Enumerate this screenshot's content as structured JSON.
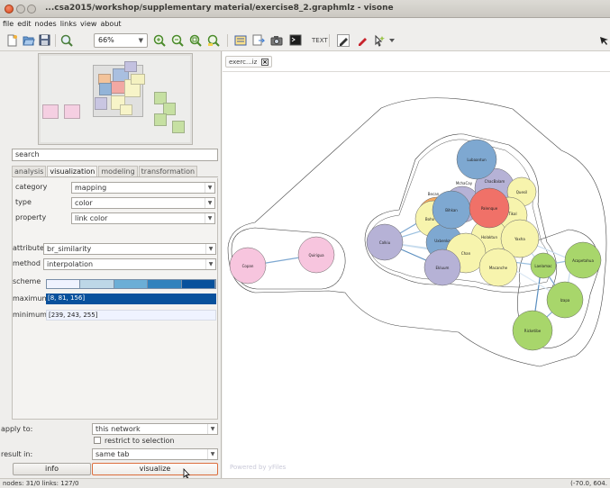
{
  "window": {
    "title": "...csa2015/workshop/supplementary material/exercise8_2.graphmlz - visone"
  },
  "menu": [
    "file",
    "edit",
    "nodes",
    "links",
    "view",
    "about"
  ],
  "toolbar": {
    "zoom": "66%",
    "text_label": "TEXT"
  },
  "search": {
    "value": "search"
  },
  "tabs": [
    "analysis",
    "visualization",
    "modeling",
    "transformation"
  ],
  "form": {
    "category": {
      "label": "category",
      "value": "mapping"
    },
    "type": {
      "label": "type",
      "value": "color"
    },
    "property": {
      "label": "property",
      "value": "link color"
    },
    "attribute": {
      "label": "attribute",
      "value": "br_similarity"
    },
    "method": {
      "label": "method",
      "value": "interpolation"
    },
    "scheme": {
      "label": "scheme",
      "colors": [
        "#eff3ff",
        "#bdd7e7",
        "#6baed6",
        "#3182bd",
        "#08519c"
      ]
    },
    "maximum": {
      "label": "maximum",
      "value": "[8, 81, 156]",
      "color": "#08519c"
    },
    "minimum": {
      "label": "minimum",
      "value": "[239, 243, 255]",
      "color": "#eff3ff"
    }
  },
  "apply": {
    "apply_label": "apply to:",
    "apply_value": "this network",
    "restrict_label": "restrict to selection",
    "result_label": "result in:",
    "result_value": "same tab",
    "info_button": "info",
    "visualize_button": "visualize"
  },
  "document_tab": {
    "label": "exerc...iz"
  },
  "canvas": {
    "powered_by": "Powered by yFiles"
  },
  "graph": {
    "nodes": [
      {
        "id": "copan",
        "label": "Copan",
        "color": "#f7c5de"
      },
      {
        "id": "quirigua",
        "label": "Quirigua",
        "color": "#f7c5de"
      },
      {
        "id": "calkiu",
        "label": "Calkiu",
        "color": "#b6b2d6"
      },
      {
        "id": "lubaantun",
        "label": "Lubaantun",
        "color": "#7ea8d1"
      },
      {
        "id": "machaquila",
        "label": "MchaCay",
        "color": "#b6b2d6"
      },
      {
        "id": "chacbalam",
        "label": "ChacBalam",
        "color": "#b6b2d6"
      },
      {
        "id": "becan",
        "label": "Becan",
        "color": "#f6a95e"
      },
      {
        "id": "quesil",
        "label": "Quesil",
        "color": "#f7f4ad"
      },
      {
        "id": "bihkan",
        "label": "Bihkan",
        "color": "#7ea8d1"
      },
      {
        "id": "palenque",
        "label": "Palenque",
        "color": "#f07168"
      },
      {
        "id": "tikal",
        "label": "Tikal",
        "color": "#f7f4ad"
      },
      {
        "id": "bolon",
        "label": "Boho",
        "color": "#f7f4ad"
      },
      {
        "id": "uxbenka",
        "label": "Uxbenka",
        "color": "#7ea8d1"
      },
      {
        "id": "holaktun",
        "label": "Holaktun",
        "color": "#f7f4ad"
      },
      {
        "id": "yaxha",
        "label": "Yaxha",
        "color": "#f7f4ad"
      },
      {
        "id": "chan",
        "label": "Chan",
        "color": "#f7f4ad"
      },
      {
        "id": "ekluum",
        "label": "Ekluum",
        "color": "#b6b2d6"
      },
      {
        "id": "macanche",
        "label": "Macanche",
        "color": "#f7f4ad"
      },
      {
        "id": "laelamac",
        "label": "Laelamac",
        "color": "#a8d66b"
      },
      {
        "id": "acapetahua",
        "label": "Acapetahua",
        "color": "#a8d66b"
      },
      {
        "id": "izapa",
        "label": "Izapa",
        "color": "#a8d66b"
      },
      {
        "id": "ricketibe",
        "label": "Ricketibe",
        "color": "#a8d66b"
      }
    ]
  },
  "status": {
    "left": "nodes: 31/0 links: 127/0",
    "right": "(-70.0, 604."
  }
}
